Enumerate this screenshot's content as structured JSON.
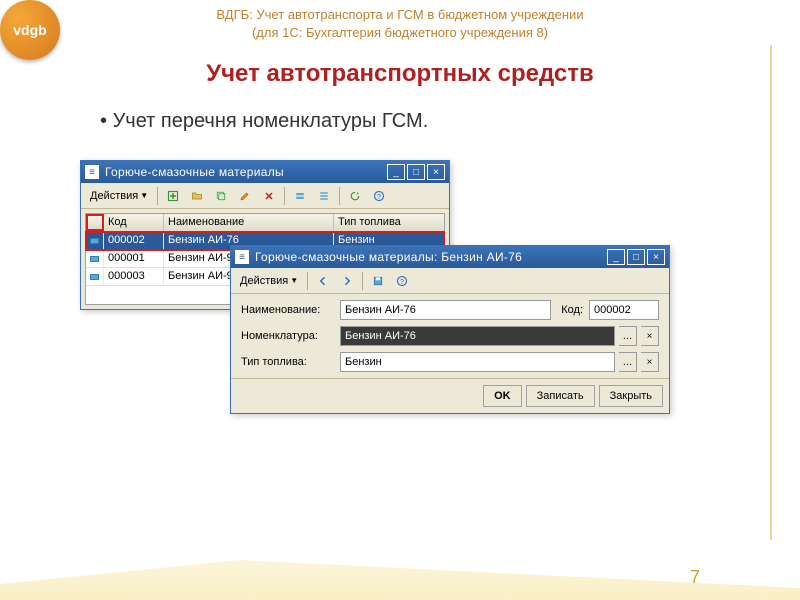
{
  "header": {
    "line1": "ВДГБ: Учет автотранспорта и ГСМ в бюджетном учреждении",
    "line2": "(для 1С: Бухгалтерия бюджетного учреждения 8)",
    "logo_text": "vdgb"
  },
  "title": "Учет автотранспортных средств",
  "bullet": "Учет перечня номенклатуры ГСМ.",
  "page_number": "7",
  "win1": {
    "title": "Горюче-смазочные материалы",
    "actions_label": "Действия",
    "columns": {
      "code": "Код",
      "name": "Наименование",
      "fuel": "Тип топлива"
    },
    "rows": [
      {
        "code": "000002",
        "name": "Бензин АИ-76",
        "fuel": "Бензин",
        "selected": true
      },
      {
        "code": "000001",
        "name": "Бензин АИ-92",
        "fuel": "",
        "selected": false
      },
      {
        "code": "000003",
        "name": "Бензин АИ-95",
        "fuel": "",
        "selected": false
      }
    ]
  },
  "win2": {
    "title": "Горюче-смазочные материалы: Бензин АИ-76",
    "actions_label": "Действия",
    "labels": {
      "name": "Наименование:",
      "code": "Код:",
      "nomen": "Номенклатура:",
      "fuel": "Тип топлива:"
    },
    "values": {
      "name": "Бензин АИ-76",
      "code": "000002",
      "nomen": "Бензин АИ-76",
      "fuel": "Бензин"
    },
    "buttons": {
      "ok": "OK",
      "save": "Записать",
      "close": "Закрыть"
    }
  }
}
